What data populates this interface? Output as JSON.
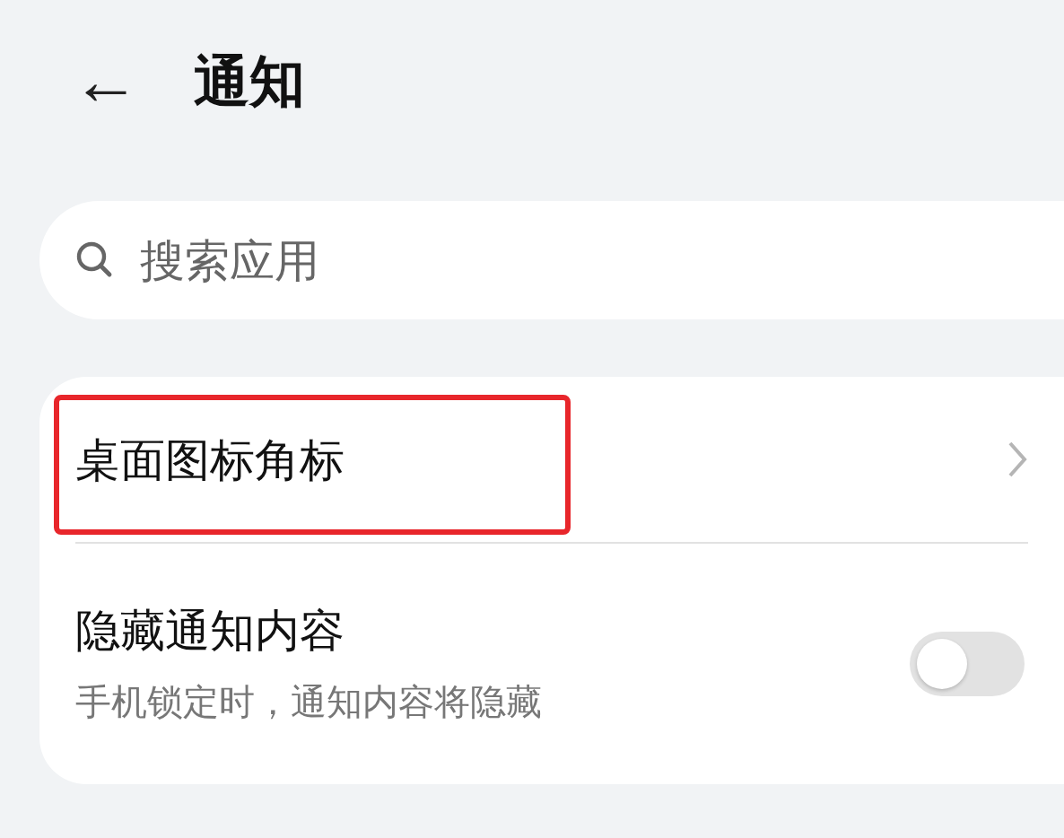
{
  "header": {
    "back": "←",
    "title": "通知"
  },
  "search": {
    "placeholder": "搜索应用"
  },
  "items": [
    {
      "kind": "link",
      "label": "桌面图标角标",
      "highlighted": true
    },
    {
      "kind": "toggle",
      "label": "隐藏通知内容",
      "subtitle": "手机锁定时，通知内容将隐藏",
      "on": false,
      "highlighted": false
    }
  ]
}
